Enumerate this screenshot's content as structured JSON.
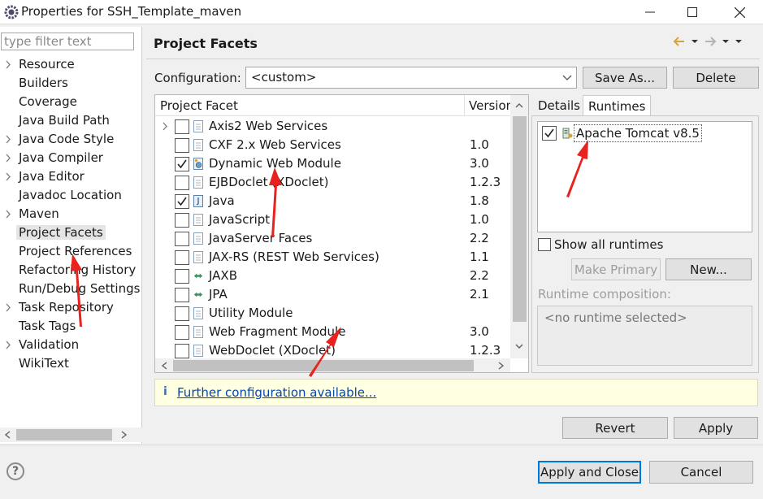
{
  "window": {
    "title": "Properties for SSH_Template_maven",
    "minimize": "─",
    "maximize": "☐",
    "close": "✕"
  },
  "sidebar": {
    "filter_placeholder": "type filter text",
    "items": [
      {
        "label": "Resource",
        "expandable": true
      },
      {
        "label": "Builders",
        "expandable": false
      },
      {
        "label": "Coverage",
        "expandable": false
      },
      {
        "label": "Java Build Path",
        "expandable": false
      },
      {
        "label": "Java Code Style",
        "expandable": true
      },
      {
        "label": "Java Compiler",
        "expandable": true
      },
      {
        "label": "Java Editor",
        "expandable": true
      },
      {
        "label": "Javadoc Location",
        "expandable": false
      },
      {
        "label": "Maven",
        "expandable": true
      },
      {
        "label": "Project Facets",
        "expandable": false,
        "selected": true
      },
      {
        "label": "Project References",
        "expandable": false
      },
      {
        "label": "Refactoring History",
        "expandable": false
      },
      {
        "label": "Run/Debug Settings",
        "expandable": false
      },
      {
        "label": "Task Repository",
        "expandable": true
      },
      {
        "label": "Task Tags",
        "expandable": false
      },
      {
        "label": "Validation",
        "expandable": true
      },
      {
        "label": "WikiText",
        "expandable": false
      }
    ]
  },
  "main": {
    "title": "Project Facets",
    "configuration_label": "Configuration:",
    "configuration_value": "<custom>",
    "save_as": "Save As...",
    "delete": "Delete",
    "table": {
      "col_facet": "Project Facet",
      "col_version": "Version",
      "rows": [
        {
          "name": "Axis2 Web Services",
          "version": "",
          "checked": false,
          "expandable": true,
          "icon": "doc"
        },
        {
          "name": "CXF 2.x Web Services",
          "version": "1.0",
          "checked": false,
          "icon": "doc"
        },
        {
          "name": "Dynamic Web Module",
          "version": "3.0",
          "checked": true,
          "icon": "web"
        },
        {
          "name": "EJBDoclet (XDoclet)",
          "version": "1.2.3",
          "checked": false,
          "icon": "doc"
        },
        {
          "name": "Java",
          "version": "1.8",
          "checked": true,
          "icon": "java"
        },
        {
          "name": "JavaScript",
          "version": "1.0",
          "checked": false,
          "icon": "doc"
        },
        {
          "name": "JavaServer Faces",
          "version": "2.2",
          "checked": false,
          "icon": "doc"
        },
        {
          "name": "JAX-RS (REST Web Services)",
          "version": "1.1",
          "checked": false,
          "icon": "doc"
        },
        {
          "name": "JAXB",
          "version": "2.2",
          "checked": false,
          "icon": "arrow"
        },
        {
          "name": "JPA",
          "version": "2.1",
          "checked": false,
          "icon": "arrow"
        },
        {
          "name": "Utility Module",
          "version": "",
          "checked": false,
          "icon": "doc"
        },
        {
          "name": "Web Fragment Module",
          "version": "3.0",
          "checked": false,
          "icon": "doc"
        },
        {
          "name": "WebDoclet (XDoclet)",
          "version": "1.2.3",
          "checked": false,
          "icon": "doc"
        }
      ]
    },
    "tabs": {
      "details": "Details",
      "runtimes": "Runtimes"
    },
    "runtimes": [
      {
        "name": "Apache Tomcat v8.5",
        "checked": true
      }
    ],
    "show_all_runtimes": "Show all runtimes",
    "make_primary": "Make Primary",
    "new_button": "New...",
    "runtime_composition_label": "Runtime composition:",
    "runtime_composition_value": "<no runtime selected>",
    "info_link": "Further configuration available...",
    "info_icon": "i",
    "revert": "Revert",
    "apply": "Apply"
  },
  "footer": {
    "help": "?",
    "apply_and_close": "Apply and Close",
    "cancel": "Cancel"
  },
  "colors": {
    "accent": "#0078d7",
    "annotation": "#e8231f",
    "info_bg": "#ffffe1",
    "link": "#0645ad"
  }
}
